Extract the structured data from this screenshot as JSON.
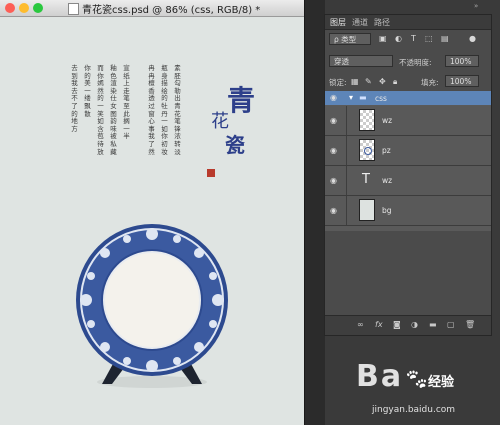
{
  "window": {
    "title": "青花瓷css.psd @ 86% (css, RGB/8) *",
    "traffic_colors": [
      "#fd5f57",
      "#febc2e",
      "#2ac83f"
    ]
  },
  "artwork": {
    "calligraphy_lines": [
      "青",
      "花",
      "瓷"
    ],
    "poem_columns": [
      "素胚勾勒出青花笔锋浓转淡",
      "瓶身描绘的牡丹一如你初妆",
      "冉冉檀香透过窗心事我了然",
      "宣纸上走笔至此搁一半",
      "釉色渲染仕女图韵味被私藏",
      "而你嫣然的一笑如含苞待放",
      "你的美一缕飘散",
      "去到我去不了的地方"
    ]
  },
  "layers_panel": {
    "tabs": [
      "图层",
      "通道",
      "路径"
    ],
    "filter_label": "ρ 类型",
    "blend_mode": "穿透",
    "opacity_label": "不透明度:",
    "opacity_value": "100%",
    "lock_label": "锁定:",
    "fill_label": "填充:",
    "fill_value": "100%",
    "group_name": "css",
    "layers": [
      {
        "name": "wz",
        "type": "pixel"
      },
      {
        "name": "pz",
        "type": "pixel"
      },
      {
        "name": "wz",
        "type": "text"
      },
      {
        "name": "bg",
        "type": "fill"
      }
    ],
    "footer_icons": [
      "link-icon",
      "fx-icon",
      "mask-icon",
      "adjustment-icon",
      "folder-icon",
      "new-layer-icon",
      "trash-icon"
    ]
  },
  "watermark": {
    "big_text": "Ba",
    "brand": "经验",
    "url": "jingyan.baidu.com"
  },
  "colors": {
    "accent_selected": "#5d85b8",
    "blue_ink": "#2d3f8a",
    "seal_red": "#b83a2c"
  }
}
